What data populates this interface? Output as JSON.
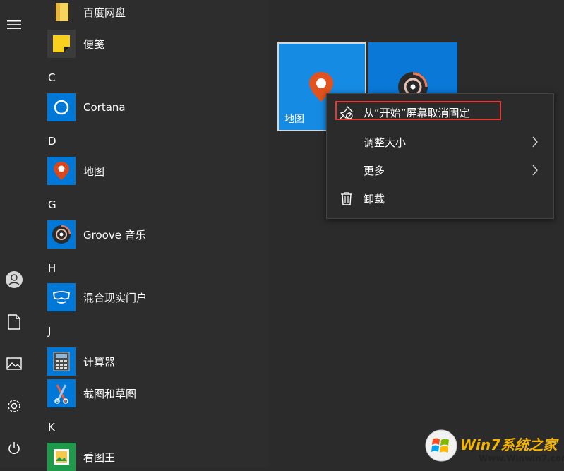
{
  "rail": {
    "icons": [
      "hamburger-icon",
      "user-icon",
      "document-icon",
      "pictures-icon",
      "settings-icon",
      "power-icon"
    ]
  },
  "applist": {
    "items": [
      {
        "type": "app",
        "label": "百度网盘",
        "icon": "folder-icon"
      },
      {
        "type": "app",
        "label": "便笺",
        "icon": "sticky-notes-icon"
      },
      {
        "type": "letter",
        "label": "C"
      },
      {
        "type": "app",
        "label": "Cortana",
        "icon": "cortana-icon"
      },
      {
        "type": "letter",
        "label": "D"
      },
      {
        "type": "app",
        "label": "地图",
        "icon": "maps-icon"
      },
      {
        "type": "letter",
        "label": "G"
      },
      {
        "type": "app",
        "label": "Groove 音乐",
        "icon": "groove-music-icon"
      },
      {
        "type": "letter",
        "label": "H"
      },
      {
        "type": "app",
        "label": "混合现实门户",
        "icon": "mixed-reality-icon"
      },
      {
        "type": "letter",
        "label": "J"
      },
      {
        "type": "app",
        "label": "计算器",
        "icon": "calculator-icon"
      },
      {
        "type": "app",
        "label": "截图和草图",
        "icon": "snip-sketch-icon"
      },
      {
        "type": "letter",
        "label": "K"
      },
      {
        "type": "app",
        "label": "看图王",
        "icon": "image-viewer-icon"
      }
    ]
  },
  "tiles": {
    "maps": {
      "label": "地图"
    },
    "groove": {
      "label": ""
    }
  },
  "context_menu": {
    "items": [
      {
        "label": "从“开始”屏幕取消固定",
        "icon": "unpin-icon",
        "submenu": false
      },
      {
        "label": "调整大小",
        "icon": "",
        "submenu": true
      },
      {
        "label": "更多",
        "icon": "",
        "submenu": true
      },
      {
        "label": "卸载",
        "icon": "trash-icon",
        "submenu": false
      }
    ]
  },
  "watermark": {
    "brand": "Win7系统之家",
    "url": "Www.Winwin7.com"
  },
  "colors": {
    "accent": "#0078d7",
    "highlight_border": "#e53935",
    "background": "#2b2b2b"
  }
}
